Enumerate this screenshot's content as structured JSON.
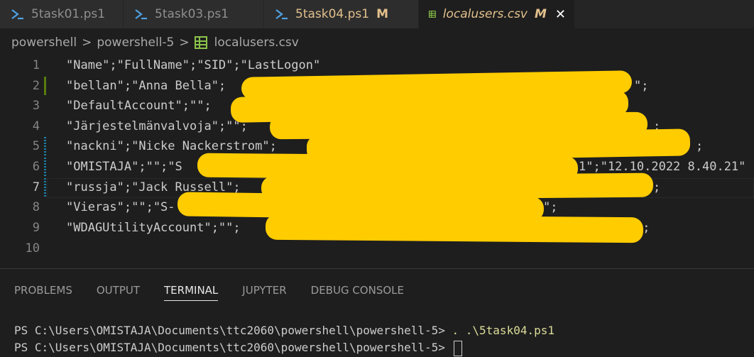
{
  "tabs": [
    {
      "name": "5task01.ps1",
      "modified": ""
    },
    {
      "name": "5task03.ps1",
      "modified": ""
    },
    {
      "name": "5task04.ps1",
      "modified": "M"
    },
    {
      "name": "localusers.csv",
      "modified": "M",
      "close": "✕"
    }
  ],
  "breadcrumb": {
    "parts": [
      "powershell",
      "powershell-5",
      "localusers.csv"
    ],
    "separator": ">"
  },
  "editor": {
    "lines": [
      {
        "num": "1",
        "text": "\"Name\";\"FullName\";\"SID\";\"LastLogon\""
      },
      {
        "num": "2",
        "text": "\"bellan\";\"Anna Bella\";",
        "tail": "\";"
      },
      {
        "num": "3",
        "text": "\"DefaultAccount\";\"\";",
        "tail": ";"
      },
      {
        "num": "4",
        "text": "\"Järjestelmänvalvoja\";\"\";",
        "tail": ";"
      },
      {
        "num": "5",
        "text": "\"nackni\";\"Nicke Nackerstrom\";",
        "tail": ";"
      },
      {
        "num": "6",
        "text": "\"OMISTAJA\";\"\";\"S",
        "tail": "1\";\"12.10.2022 8.40.21\""
      },
      {
        "num": "7",
        "text": "\"russja\";\"Jack Russell\";",
        "tail": ";"
      },
      {
        "num": "8",
        "text": "\"Vieras\";\"\";\"S-",
        "tail": "\";"
      },
      {
        "num": "9",
        "text": "\"WDAGUtilityAccount\";\"\";",
        "tail": "\";"
      },
      {
        "num": "10",
        "text": ""
      }
    ],
    "redaction_color": "#ffcc00"
  },
  "panel": {
    "tabs": [
      "PROBLEMS",
      "OUTPUT",
      "TERMINAL",
      "JUPYTER",
      "DEBUG CONSOLE"
    ],
    "active": "TERMINAL",
    "terminal": [
      {
        "prompt": "PS C:\\Users\\OMISTAJA\\Documents\\ttc2060\\powershell\\powershell-5> ",
        "cmd": ". .\\5task04.ps1"
      },
      {
        "prompt": "PS C:\\Users\\OMISTAJA\\Documents\\ttc2060\\powershell\\powershell-5> ",
        "cmd": ""
      }
    ]
  },
  "icons": {
    "powershell": "powershell-icon",
    "csv": "csv-file-icon"
  }
}
